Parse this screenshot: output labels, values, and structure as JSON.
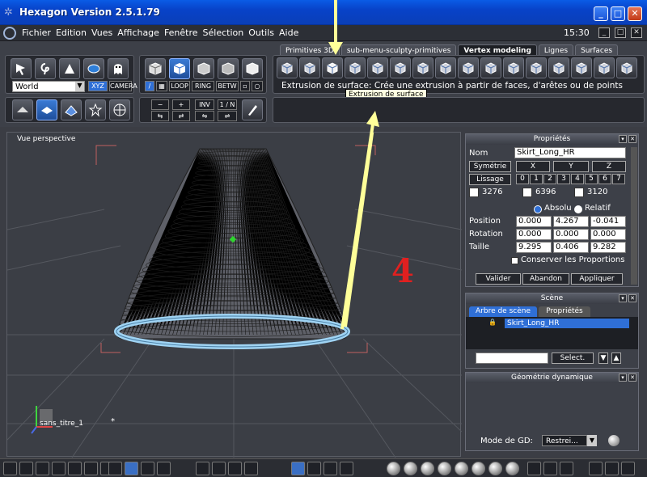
{
  "window": {
    "title": "Hexagon Version 2.5.1.79",
    "min": "_",
    "max": "□",
    "close": "✕"
  },
  "menu": {
    "items": [
      "Fichier",
      "Edition",
      "Vues",
      "Affichage",
      "Fenêtre",
      "Sélection",
      "Outils",
      "Aide"
    ],
    "clock": "15:30"
  },
  "toolbar": {
    "coord_select": "World",
    "xyz": "XYZ",
    "camera": "CAMERA",
    "mode_labels": [
      "LOOP",
      "RING",
      "BETW"
    ],
    "buttons2": [
      "−",
      "+",
      "INV",
      "1 / N"
    ],
    "tabs": [
      "Primitives 3D",
      "sub-menu-sculpty-primitives",
      "Vertex modeling",
      "Lignes",
      "Surfaces"
    ],
    "active_tab": "Vertex modeling",
    "description": "Extrusion de surface: Crée une extrusion à partir de faces, d'arêtes ou de points",
    "tooltip": "Extrusion de surface"
  },
  "viewport": {
    "label": "Vue perspective",
    "file_label": "sans_titre_1",
    "modified_mark": "*",
    "annotation": "4"
  },
  "properties": {
    "title": "Propriétés",
    "name_label": "Nom",
    "name_value": "Skirt_Long_HR",
    "symmetry_label": "Symétrie",
    "axes": [
      "X",
      "Y",
      "Z"
    ],
    "smoothing_label": "Lissage",
    "levels": [
      "0",
      "1",
      "2",
      "3",
      "4",
      "5",
      "6",
      "7"
    ],
    "counts": [
      "3276",
      "6396",
      "3120"
    ],
    "absolute": "Absolu",
    "relative": "Relatif",
    "position_label": "Position",
    "position": [
      "0.000",
      "4.267",
      "-0.041"
    ],
    "rotation_label": "Rotation",
    "rotation": [
      "0.000",
      "0.000",
      "0.000"
    ],
    "size_label": "Taille",
    "size": [
      "9.295",
      "0.406",
      "9.282"
    ],
    "keep_proportions": "Conserver les Proportions",
    "validate": "Valider",
    "cancel": "Abandon",
    "apply": "Appliquer"
  },
  "scene": {
    "title": "Scène",
    "tabs": [
      "Arbre de scène",
      "Propriétés"
    ],
    "item": "Skirt_Long_HR",
    "select": "Select."
  },
  "dyn_geom": {
    "title": "Géométrie dynamique",
    "mode_label": "Mode de GD:",
    "mode_value": "Restrei..."
  },
  "colors": {
    "accent": "#2f6fd6",
    "mesh": "#2a2a2a",
    "ring": "#8ec9ee",
    "arrow": "#ffff99"
  }
}
